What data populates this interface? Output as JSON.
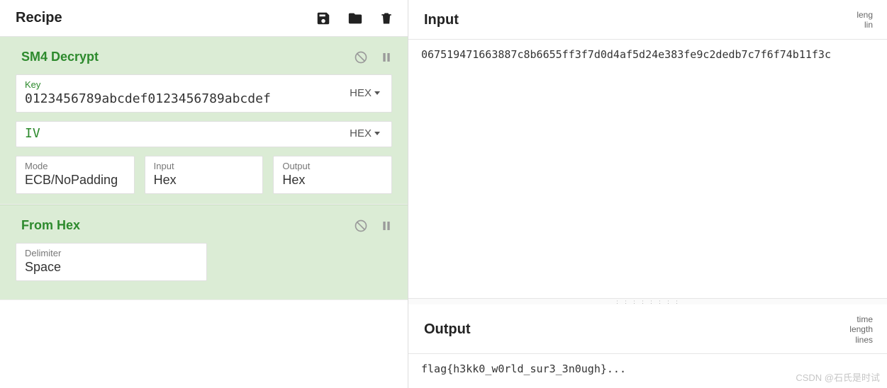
{
  "recipe": {
    "title": "Recipe",
    "icons": {
      "save": "save-icon",
      "folder": "folder-icon",
      "delete": "trash-icon"
    }
  },
  "ops": [
    {
      "name": "SM4 Decrypt",
      "key": {
        "label": "Key",
        "value": "0123456789abcdef0123456789abcdef",
        "encoding": "HEX"
      },
      "iv": {
        "label": "IV",
        "value": "",
        "encoding": "HEX"
      },
      "mode": {
        "label": "Mode",
        "value": "ECB/NoPadding"
      },
      "input": {
        "label": "Input",
        "value": "Hex"
      },
      "output": {
        "label": "Output",
        "value": "Hex"
      }
    },
    {
      "name": "From Hex",
      "delimiter": {
        "label": "Delimiter",
        "value": "Space"
      }
    }
  ],
  "input": {
    "title": "Input",
    "meta1": "leng",
    "meta2": "lin",
    "text": "067519471663887c8b6655ff3f7d0d4af5d24e383fe9c2dedb7c7f6f74b11f3c"
  },
  "output": {
    "title": "Output",
    "meta1": "time",
    "meta2": "length",
    "meta3": "lines",
    "text": "flag{h3kk0_w0rld_sur3_3n0ugh}..."
  },
  "watermark": "CSDN @石氏是时试"
}
